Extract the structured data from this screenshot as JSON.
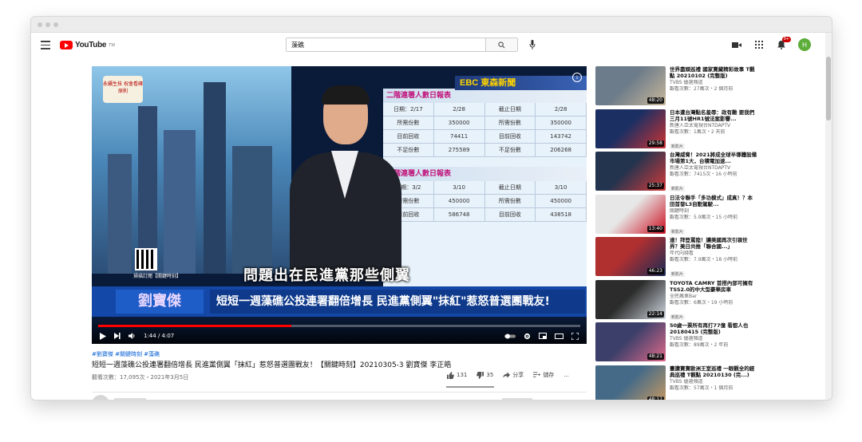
{
  "header": {
    "logo_text": "YouTube",
    "logo_sup": "TW",
    "search_value": "藻礁",
    "notification_count": "9+",
    "avatar_letter": "H"
  },
  "player": {
    "channel_logo": "永續生技 祝會看確原則",
    "broadcaster": "EBC 東森新聞",
    "board_title_1": "二階連署人數日報表",
    "board_rows_1": [
      [
        "日期：2/17",
        "2/28",
        "截止日期",
        "2/28"
      ],
      [
        "所需份數",
        "350000",
        "所需份數",
        "350000"
      ],
      [
        "目前回收",
        "74411",
        "目前回收",
        "143742"
      ],
      [
        "不足份數",
        "275589",
        "不足份數",
        "206268"
      ]
    ],
    "board_title_2": "二階連署人數日報表",
    "board_rows_2": [
      [
        "日期：3/2",
        "3/10",
        "截止日期",
        "3/10"
      ],
      [
        "所需份數",
        "450000",
        "所需份數",
        "450000"
      ],
      [
        "目前回收",
        "586748",
        "目前回收",
        "438518"
      ]
    ],
    "caption": "問題出在民進黨那些側翼",
    "lower_name": "劉寶傑",
    "lower_title": "短短一週藻礁公投連署翻倍增長 民進黨側翼\"抹紅\"惹怒普選團戰友!",
    "qr_label": "掃描訂閱【關鍵時刻】",
    "progress_fraction": 0.4,
    "time": "1:44 / 4:07"
  },
  "video": {
    "tags": "#劉寶傑 #關鍵時刻 #藻礁",
    "title": "短短一週藻礁公投連署翻倍增長 民進黨側翼「抹紅」惹怒普選團戰友！【關鍵時刻】20210305-3 劉寶傑 李正皓",
    "meta": "觀看次數：17,095次・2021年3月5日",
    "likes": "131",
    "dislikes": "35",
    "share": "分享",
    "save": "儲存",
    "more": "..."
  },
  "sidebar": [
    {
      "title": "世界盡頭巡禮 國家寶藏精彩故事 T觀點 20210102 (完整版)",
      "channel": "TVBS 優選頻道",
      "views": "觀看次數：27萬次・2 個月前",
      "duration": "48:20",
      "colors": [
        "#6d7c8a",
        "#c8b79a"
      ],
      "new": ""
    },
    {
      "title": "日本遭台灣點名羞辱：政有難 要我們三月11號HR1號法案影響...",
      "channel": "新唐人亞太電視台NTDAPTV",
      "views": "觀看次數：1萬次・2 天前",
      "duration": "29:58",
      "colors": [
        "#1b2f63",
        "#c33"
      ],
      "new": "新影片"
    },
    {
      "title": "台灣威脅！2021將成全球半導體設備市場第1大，台積電加速...",
      "channel": "新唐人亞太電視台NTDAPTV",
      "views": "觀看次數：7415次・16 小時前",
      "duration": "25:37",
      "colors": [
        "#23344f",
        "#d43a3a"
      ],
      "new": "新影片"
    },
    {
      "title": "日法令聯手「多功模式」成真！？本田首發L3自動駕駛...",
      "channel": "關鍵時刻",
      "views": "觀看次數：5.9萬次・15 小時前",
      "duration": "13:40",
      "colors": [
        "#e7e7e7",
        "#c12"
      ],
      "new": "新影片"
    },
    {
      "title": "達！拜登罵陸！讓美國再次引領世界？美日共推「聯合國...」",
      "channel": "年代向錢看",
      "views": "觀看次數：7.9萬次・18 小時前",
      "duration": "46:23",
      "colors": [
        "#b03030",
        "#1a2a55"
      ],
      "new": "新影片"
    },
    {
      "title": "TOYOTA CAMRY 首搭內部可擁有TSS2.0的中大型豪華房車",
      "channel": "全民瘋車Bar",
      "views": "觀看次數：6萬次・19 小時前",
      "duration": "22:14",
      "colors": [
        "#2c2c2c",
        "#cfd8e0"
      ],
      "new": "新影片"
    },
    {
      "title": "50歲一票所有再打77億 看都人也 20180415 (完整版)",
      "channel": "TVBS 優選頻道",
      "views": "觀看次數：89萬次・2 年前",
      "duration": "48:21",
      "colors": [
        "#3b3f6a",
        "#e06a8a"
      ],
      "new": ""
    },
    {
      "title": "畫讚寶寶歐洲王室巡禮 一眼觀全的經典巡禮 T觀點 20210130 (完...)",
      "channel": "TVBS 優選頻道",
      "views": "觀看次數：57萬次・1 個月前",
      "duration": "48:17",
      "colors": [
        "#446a88",
        "#c99a62"
      ],
      "new": ""
    }
  ]
}
